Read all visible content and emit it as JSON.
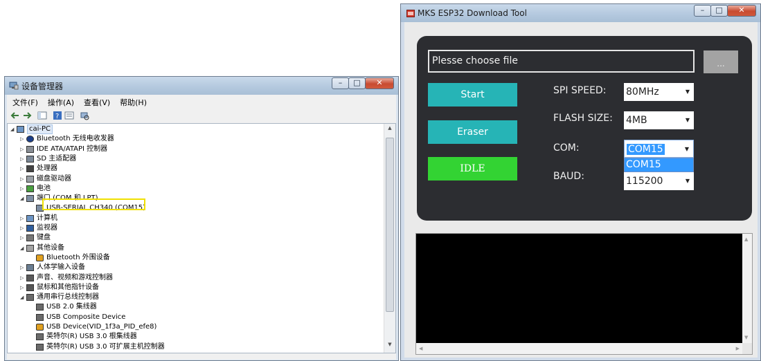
{
  "device_manager": {
    "title": "设备管理器",
    "menu": [
      "文件(F)",
      "操作(A)",
      "查看(V)",
      "帮助(H)"
    ],
    "tree": [
      {
        "level": 0,
        "expanded": true,
        "label": "cai-PC",
        "icon": "computer-icon"
      },
      {
        "level": 1,
        "expanded": false,
        "label": "Bluetooth 无线电收发器",
        "icon": "bluetooth-icon"
      },
      {
        "level": 1,
        "expanded": false,
        "label": "IDE ATA/ATAPI 控制器",
        "icon": "ide-controller-icon"
      },
      {
        "level": 1,
        "expanded": false,
        "label": "SD 主适配器",
        "icon": "sd-adapter-icon"
      },
      {
        "level": 1,
        "expanded": false,
        "label": "处理器",
        "icon": "processor-icon"
      },
      {
        "level": 1,
        "expanded": false,
        "label": "磁盘驱动器",
        "icon": "disk-drive-icon"
      },
      {
        "level": 1,
        "expanded": false,
        "label": "电池",
        "icon": "battery-icon"
      },
      {
        "level": 1,
        "expanded": true,
        "label": "端口 (COM 和 LPT)",
        "icon": "port-icon"
      },
      {
        "level": 2,
        "expanded": null,
        "label": "USB-SERIAL CH340 (COM15)",
        "icon": "port-icon",
        "highlighted": true
      },
      {
        "level": 1,
        "expanded": false,
        "label": "计算机",
        "icon": "computer-icon"
      },
      {
        "level": 1,
        "expanded": false,
        "label": "监视器",
        "icon": "monitor-icon"
      },
      {
        "level": 1,
        "expanded": false,
        "label": "键盘",
        "icon": "keyboard-icon"
      },
      {
        "level": 1,
        "expanded": true,
        "label": "其他设备",
        "icon": "other-devices-icon"
      },
      {
        "level": 2,
        "expanded": null,
        "label": "Bluetooth 外围设备",
        "icon": "warning-device-icon"
      },
      {
        "level": 1,
        "expanded": false,
        "label": "人体学输入设备",
        "icon": "hid-icon"
      },
      {
        "level": 1,
        "expanded": false,
        "label": "声音、视频和游戏控制器",
        "icon": "speaker-icon"
      },
      {
        "level": 1,
        "expanded": false,
        "label": "鼠标和其他指针设备",
        "icon": "mouse-icon"
      },
      {
        "level": 1,
        "expanded": true,
        "label": "通用串行总线控制器",
        "icon": "usb-icon"
      },
      {
        "level": 2,
        "expanded": null,
        "label": "USB 2.0 集线器",
        "icon": "usb-icon"
      },
      {
        "level": 2,
        "expanded": null,
        "label": "USB Composite Device",
        "icon": "usb-icon"
      },
      {
        "level": 2,
        "expanded": null,
        "label": "USB Device(VID_1f3a_PID_efe8)",
        "icon": "warning-device-icon"
      },
      {
        "level": 2,
        "expanded": null,
        "label": "英特尔(R) USB 3.0 根集线器",
        "icon": "usb-icon"
      },
      {
        "level": 2,
        "expanded": null,
        "label": "英特尔(R) USB 3.0 可扩展主机控制器",
        "icon": "usb-icon"
      }
    ]
  },
  "esp_tool": {
    "title": "MKS ESP32 Download Tool",
    "file_input": "Plesse choose file",
    "browse_label": "...",
    "buttons": {
      "start": "Start",
      "eraser": "Eraser",
      "status": "IDLE"
    },
    "fields": {
      "spi_speed": {
        "label": "SPI SPEED:",
        "value": "80MHz"
      },
      "flash_size": {
        "label": "FLASH SIZE:",
        "value": "4MB"
      },
      "com": {
        "label": "COM:",
        "value": "COM15",
        "dropdown_open_option": "COM15"
      },
      "baud": {
        "label": "BAUD:",
        "value": "115200"
      }
    }
  },
  "colors": {
    "panel_bg": "#2c2d31",
    "teal_button": "#26b4b6",
    "idle_green": "#33d333",
    "selection_blue": "#3399ff",
    "highlight_yellow": "#f0e000"
  }
}
